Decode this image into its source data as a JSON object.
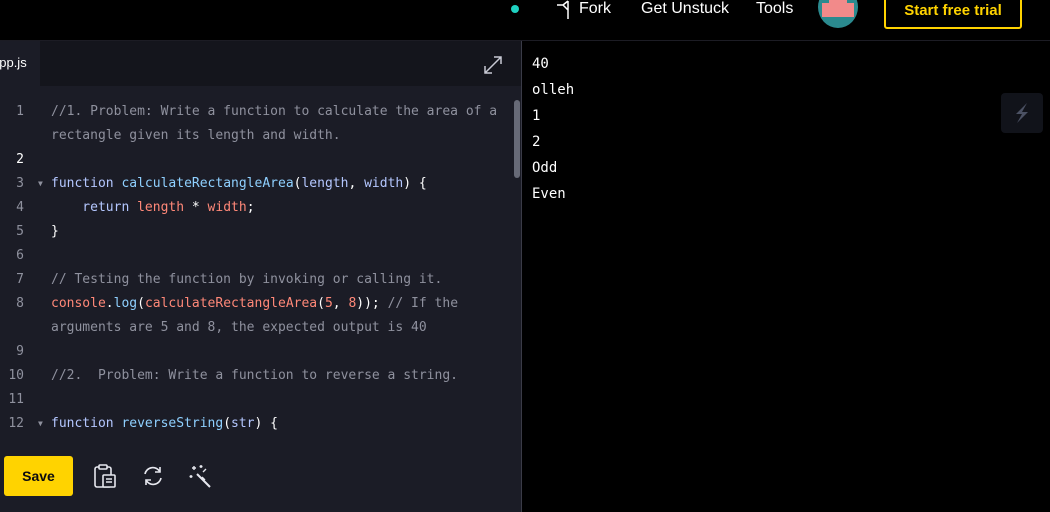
{
  "nav": {
    "fork_label": "Fork",
    "get_unstuck_label": "Get Unstuck",
    "tools_label": "Tools",
    "cta_label": "Start free trial",
    "accent_color": "#ffd300",
    "status_dot_color": "#1fd1c1"
  },
  "editor": {
    "file_tab": "app.js",
    "save_label": "Save",
    "lines": [
      {
        "num": "1",
        "segments": [
          {
            "t": "//1. Problem: Write a function to calculate the area of a",
            "c": "comment"
          }
        ]
      },
      {
        "num": "",
        "segments": [
          {
            "t": "rectangle given its length and width.",
            "c": "comment"
          }
        ]
      },
      {
        "num": "2",
        "active": true,
        "segments": []
      },
      {
        "num": "3",
        "fold": true,
        "segments": [
          {
            "t": "function ",
            "c": "kw"
          },
          {
            "t": "calculateRectangleArea",
            "c": "fn"
          },
          {
            "t": "(",
            "c": "plain"
          },
          {
            "t": "length",
            "c": "kw"
          },
          {
            "t": ", ",
            "c": "plain"
          },
          {
            "t": "width",
            "c": "kw"
          },
          {
            "t": ") {",
            "c": "plain"
          }
        ]
      },
      {
        "num": "4",
        "segments": [
          {
            "t": "    return ",
            "c": "kw"
          },
          {
            "t": "length",
            "c": "var"
          },
          {
            "t": " * ",
            "c": "plain"
          },
          {
            "t": "width",
            "c": "var"
          },
          {
            "t": ";",
            "c": "plain"
          }
        ]
      },
      {
        "num": "5",
        "segments": [
          {
            "t": "}",
            "c": "plain"
          }
        ]
      },
      {
        "num": "6",
        "segments": []
      },
      {
        "num": "7",
        "segments": [
          {
            "t": "// Testing the function by invoking or calling it.",
            "c": "comment"
          }
        ]
      },
      {
        "num": "8",
        "segments": [
          {
            "t": "console",
            "c": "var"
          },
          {
            "t": ".",
            "c": "plain"
          },
          {
            "t": "log",
            "c": "fn"
          },
          {
            "t": "(",
            "c": "plain"
          },
          {
            "t": "calculateRectangleArea",
            "c": "var"
          },
          {
            "t": "(",
            "c": "plain"
          },
          {
            "t": "5",
            "c": "num"
          },
          {
            "t": ", ",
            "c": "plain"
          },
          {
            "t": "8",
            "c": "num"
          },
          {
            "t": ")); ",
            "c": "plain"
          },
          {
            "t": "// If the",
            "c": "comment"
          }
        ]
      },
      {
        "num": "",
        "segments": [
          {
            "t": "arguments are 5 and 8, the expected output is 40",
            "c": "comment"
          }
        ]
      },
      {
        "num": "9",
        "segments": []
      },
      {
        "num": "10",
        "segments": [
          {
            "t": "//2.  Problem: Write a function to reverse a string.",
            "c": "comment"
          }
        ]
      },
      {
        "num": "11",
        "segments": []
      },
      {
        "num": "12",
        "fold": true,
        "segments": [
          {
            "t": "function ",
            "c": "kw"
          },
          {
            "t": "reverseString",
            "c": "fn"
          },
          {
            "t": "(",
            "c": "plain"
          },
          {
            "t": "str",
            "c": "kw"
          },
          {
            "t": ") {",
            "c": "plain"
          }
        ]
      }
    ]
  },
  "output": {
    "lines": [
      "40",
      "olleh",
      "1",
      "2",
      "Odd",
      "Even"
    ]
  }
}
